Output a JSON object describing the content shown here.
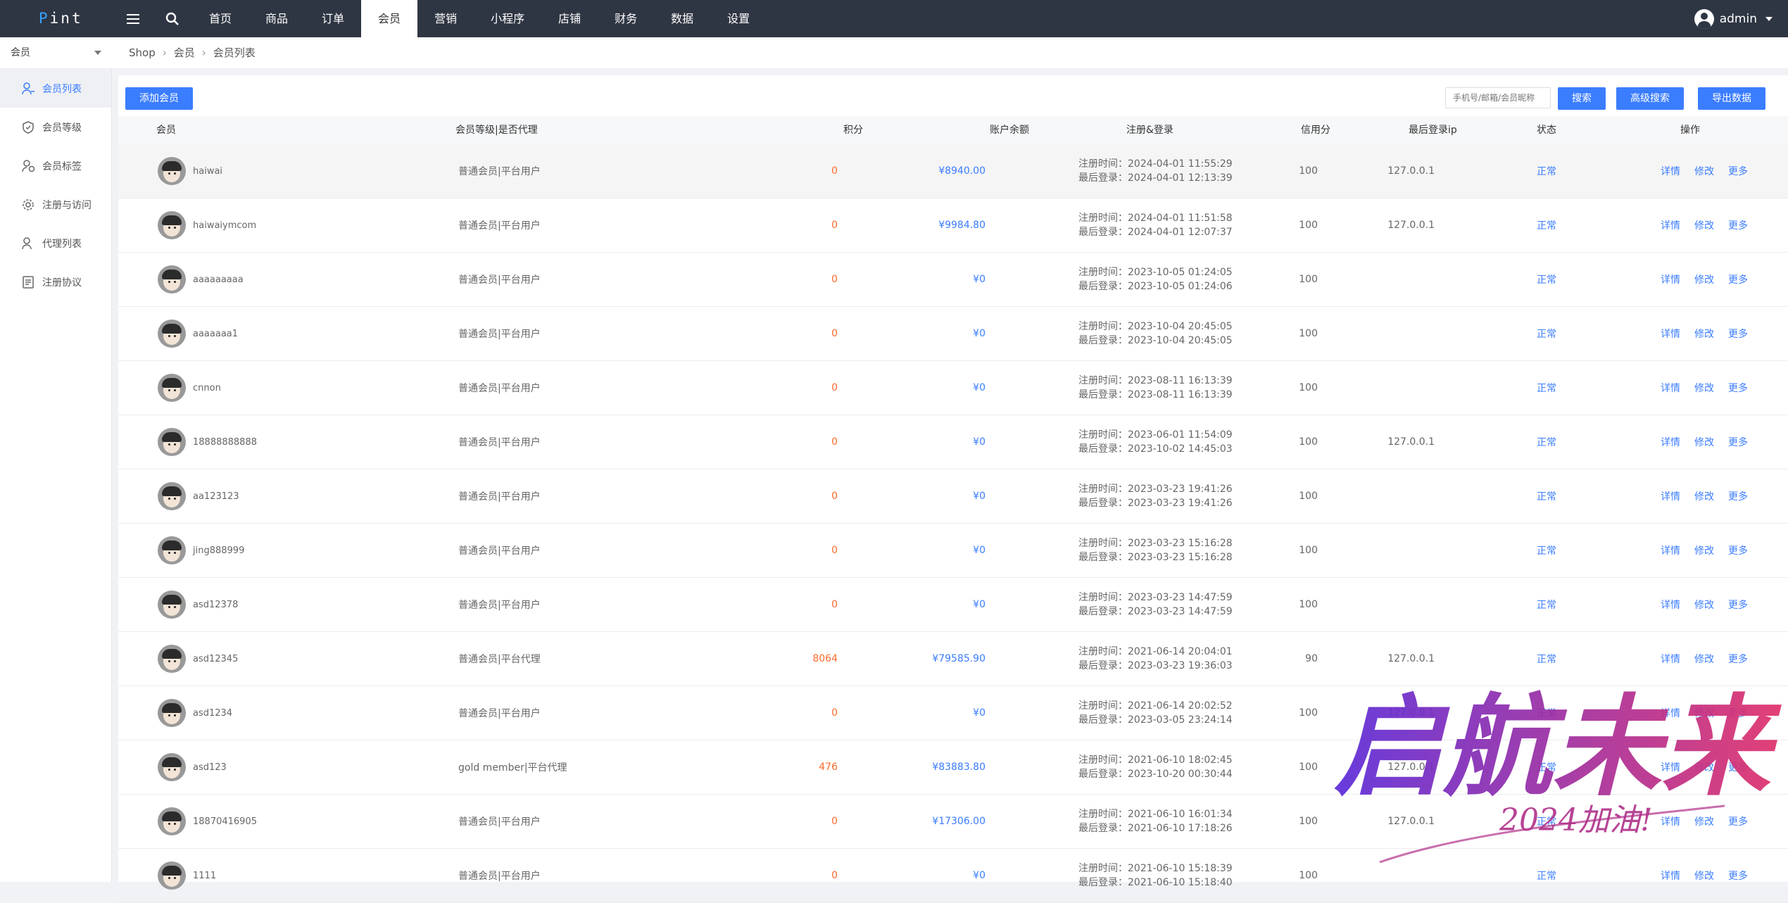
{
  "topbar": {
    "logo_prefix": "P",
    "logo_rest": "int",
    "nav": [
      {
        "label": "首页",
        "active": false
      },
      {
        "label": "商品",
        "active": false
      },
      {
        "label": "订单",
        "active": false
      },
      {
        "label": "会员",
        "active": true
      },
      {
        "label": "营销",
        "active": false
      },
      {
        "label": "小程序",
        "active": false
      },
      {
        "label": "店铺",
        "active": false
      },
      {
        "label": "财务",
        "active": false
      },
      {
        "label": "数据",
        "active": false
      },
      {
        "label": "设置",
        "active": false
      }
    ],
    "username": "admin"
  },
  "sidebar": {
    "header": "会员",
    "items": [
      {
        "label": "会员列表",
        "icon": "user-icon",
        "active": true
      },
      {
        "label": "会员等级",
        "icon": "shield-icon",
        "active": false
      },
      {
        "label": "会员标签",
        "icon": "user-tag-icon",
        "active": false
      },
      {
        "label": "注册与访问",
        "icon": "gear-icon",
        "active": false
      },
      {
        "label": "代理列表",
        "icon": "user-icon",
        "active": false
      },
      {
        "label": "注册协议",
        "icon": "document-icon",
        "active": false
      }
    ]
  },
  "breadcrumb": [
    "Shop",
    "会员",
    "会员列表"
  ],
  "toolbar": {
    "add_label": "添加会员",
    "search_placeholder": "手机号/邮箱/会员昵称",
    "search_label": "搜索",
    "advanced_label": "高级搜索",
    "export_label": "导出数据"
  },
  "table": {
    "headers": {
      "member": "会员",
      "level": "会员等级|是否代理",
      "points": "积分",
      "balance": "账户余额",
      "reg_login": "注册&登录",
      "credit": "信用分",
      "last_ip": "最后登录ip",
      "status": "状态",
      "ops": "操作"
    },
    "op_labels": {
      "detail": "详情",
      "edit": "修改",
      "more": "更多"
    },
    "rows": [
      {
        "name": "haiwai",
        "level": "普通会员|平台用户",
        "points": "0",
        "balance": "¥8940.00",
        "reg": "注册时间：2024-04-01 11:55:29",
        "login": "最后登录：2024-04-01 12:13:39",
        "credit": "100",
        "ip": "127.0.0.1",
        "status": "正常"
      },
      {
        "name": "haiwaiymcom",
        "level": "普通会员|平台用户",
        "points": "0",
        "balance": "¥9984.80",
        "reg": "注册时间：2024-04-01 11:51:58",
        "login": "最后登录：2024-04-01 12:07:37",
        "credit": "100",
        "ip": "127.0.0.1",
        "status": "正常"
      },
      {
        "name": "aaaaaaaaa",
        "level": "普通会员|平台用户",
        "points": "0",
        "balance": "¥0",
        "reg": "注册时间：2023-10-05 01:24:05",
        "login": "最后登录：2023-10-05 01:24:06",
        "credit": "100",
        "ip": "",
        "status": "正常"
      },
      {
        "name": "aaaaaaa1",
        "level": "普通会员|平台用户",
        "points": "0",
        "balance": "¥0",
        "reg": "注册时间：2023-10-04 20:45:05",
        "login": "最后登录：2023-10-04 20:45:05",
        "credit": "100",
        "ip": "",
        "status": "正常"
      },
      {
        "name": "cnnon",
        "level": "普通会员|平台用户",
        "points": "0",
        "balance": "¥0",
        "reg": "注册时间：2023-08-11 16:13:39",
        "login": "最后登录：2023-08-11 16:13:39",
        "credit": "100",
        "ip": "",
        "status": "正常"
      },
      {
        "name": "18888888888",
        "level": "普通会员|平台用户",
        "points": "0",
        "balance": "¥0",
        "reg": "注册时间：2023-06-01 11:54:09",
        "login": "最后登录：2023-10-02 14:45:03",
        "credit": "100",
        "ip": "127.0.0.1",
        "status": "正常"
      },
      {
        "name": "aa123123",
        "level": "普通会员|平台用户",
        "points": "0",
        "balance": "¥0",
        "reg": "注册时间：2023-03-23 19:41:26",
        "login": "最后登录：2023-03-23 19:41:26",
        "credit": "100",
        "ip": "",
        "status": "正常"
      },
      {
        "name": "jing888999",
        "level": "普通会员|平台用户",
        "points": "0",
        "balance": "¥0",
        "reg": "注册时间：2023-03-23 15:16:28",
        "login": "最后登录：2023-03-23 15:16:28",
        "credit": "100",
        "ip": "",
        "status": "正常"
      },
      {
        "name": "asd12378",
        "level": "普通会员|平台用户",
        "points": "0",
        "balance": "¥0",
        "reg": "注册时间：2023-03-23 14:47:59",
        "login": "最后登录：2023-03-23 14:47:59",
        "credit": "100",
        "ip": "",
        "status": "正常"
      },
      {
        "name": "asd12345",
        "level": "普通会员|平台代理",
        "points": "8064",
        "balance": "¥79585.90",
        "reg": "注册时间：2021-06-14 20:04:01",
        "login": "最后登录：2023-03-23 19:36:03",
        "credit": "90",
        "ip": "127.0.0.1",
        "status": "正常"
      },
      {
        "name": "asd1234",
        "level": "普通会员|平台用户",
        "points": "0",
        "balance": "¥0",
        "reg": "注册时间：2021-06-14 20:02:52",
        "login": "最后登录：2023-03-05 23:24:14",
        "credit": "100",
        "ip": "127.0.0.1",
        "status": "正常"
      },
      {
        "name": "asd123",
        "level": "gold member|平台代理",
        "points": "476",
        "balance": "¥83883.80",
        "reg": "注册时间：2021-06-10 18:02:45",
        "login": "最后登录：2023-10-20 00:30:44",
        "credit": "100",
        "ip": "127.0.0.1",
        "status": "正常"
      },
      {
        "name": "18870416905",
        "level": "普通会员|平台用户",
        "points": "0",
        "balance": "¥17306.00",
        "reg": "注册时间：2021-06-10 16:01:34",
        "login": "最后登录：2021-06-10 17:18:26",
        "credit": "100",
        "ip": "127.0.0.1",
        "status": "正常"
      },
      {
        "name": "1111",
        "level": "普通会员|平台用户",
        "points": "0",
        "balance": "¥0",
        "reg": "注册时间：2021-06-10 15:18:39",
        "login": "最后登录：2021-06-10 15:18:40",
        "credit": "100",
        "ip": "",
        "status": "正常"
      }
    ]
  },
  "watermark": {
    "main": "启航未来",
    "sub": "2024加油!"
  },
  "colors": {
    "topbar": "#2f3643",
    "accent": "#3b7dff",
    "points": "#ff6b2c",
    "logo_accent": "#35a3ff"
  }
}
